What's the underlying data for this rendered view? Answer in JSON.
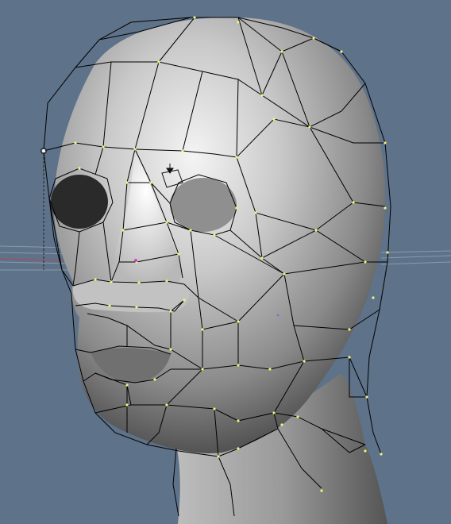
{
  "viewport": {
    "name": "3d-viewport",
    "background": "#5e7289",
    "mesh_subject": "head",
    "wire_color": "#000000",
    "vertex_color": "#f5f27a",
    "selected_vertex_color": "#ffffff",
    "grid_color": "#8a9aab",
    "axis_x_color": "#b04c55",
    "cursor_icon": "3d-cursor-icon",
    "object_center_color": "#d040d0"
  }
}
